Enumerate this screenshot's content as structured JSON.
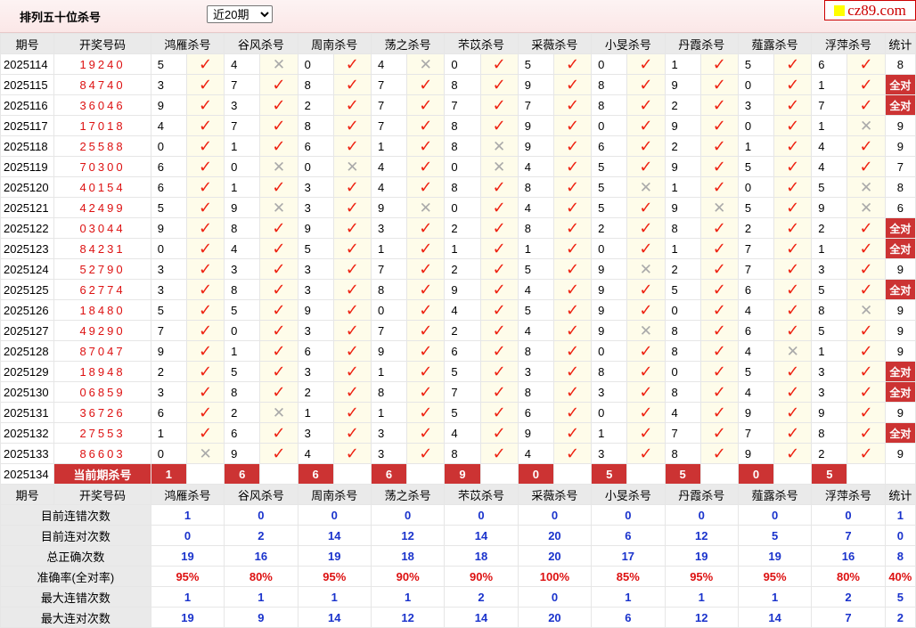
{
  "header": {
    "title": "排列五十位杀号",
    "period_select": "近20期",
    "logo": "cz89.com"
  },
  "columns": {
    "period": "期号",
    "draw": "开奖号码",
    "stat": "统计",
    "experts": [
      "鸿雁杀号",
      "谷风杀号",
      "周南杀号",
      "荡之杀号",
      "芣苡杀号",
      "采薇杀号",
      "小旻杀号",
      "丹霞杀号",
      "薤露杀号",
      "浮萍杀号"
    ]
  },
  "alltrue_label": "全对",
  "rows": [
    {
      "period": "2025114",
      "draw": "19240",
      "kills": [
        "5",
        "4",
        "0",
        "4",
        "0",
        "5",
        "0",
        "1",
        "5",
        "6"
      ],
      "ok": [
        1,
        0,
        1,
        0,
        1,
        1,
        1,
        1,
        1,
        1
      ],
      "stat": "8"
    },
    {
      "period": "2025115",
      "draw": "84740",
      "kills": [
        "3",
        "7",
        "8",
        "7",
        "8",
        "9",
        "8",
        "9",
        "0",
        "1"
      ],
      "ok": [
        1,
        1,
        1,
        1,
        1,
        1,
        1,
        1,
        1,
        1
      ],
      "stat": "全对"
    },
    {
      "period": "2025116",
      "draw": "36046",
      "kills": [
        "9",
        "3",
        "2",
        "7",
        "7",
        "7",
        "8",
        "2",
        "3",
        "7"
      ],
      "ok": [
        1,
        1,
        1,
        1,
        1,
        1,
        1,
        1,
        1,
        1
      ],
      "stat": "全对"
    },
    {
      "period": "2025117",
      "draw": "17018",
      "kills": [
        "4",
        "7",
        "8",
        "7",
        "8",
        "9",
        "0",
        "9",
        "0",
        "1"
      ],
      "ok": [
        1,
        1,
        1,
        1,
        1,
        1,
        1,
        1,
        1,
        0
      ],
      "stat": "9"
    },
    {
      "period": "2025118",
      "draw": "25588",
      "kills": [
        "0",
        "1",
        "6",
        "1",
        "8",
        "9",
        "6",
        "2",
        "1",
        "4"
      ],
      "ok": [
        1,
        1,
        1,
        1,
        0,
        1,
        1,
        1,
        1,
        1
      ],
      "stat": "9"
    },
    {
      "period": "2025119",
      "draw": "70300",
      "kills": [
        "6",
        "0",
        "0",
        "4",
        "0",
        "4",
        "5",
        "9",
        "5",
        "4"
      ],
      "ok": [
        1,
        0,
        0,
        1,
        0,
        1,
        1,
        1,
        1,
        1
      ],
      "stat": "7"
    },
    {
      "period": "2025120",
      "draw": "40154",
      "kills": [
        "6",
        "1",
        "3",
        "4",
        "8",
        "8",
        "5",
        "1",
        "0",
        "5"
      ],
      "ok": [
        1,
        1,
        1,
        1,
        1,
        1,
        0,
        1,
        1,
        0
      ],
      "stat": "8"
    },
    {
      "period": "2025121",
      "draw": "42499",
      "kills": [
        "5",
        "9",
        "3",
        "9",
        "0",
        "4",
        "5",
        "9",
        "5",
        "9"
      ],
      "ok": [
        1,
        0,
        1,
        0,
        1,
        1,
        1,
        0,
        1,
        0
      ],
      "stat": "6"
    },
    {
      "period": "2025122",
      "draw": "03044",
      "kills": [
        "9",
        "8",
        "9",
        "3",
        "2",
        "8",
        "2",
        "8",
        "2",
        "2"
      ],
      "ok": [
        1,
        1,
        1,
        1,
        1,
        1,
        1,
        1,
        1,
        1
      ],
      "stat": "全对"
    },
    {
      "period": "2025123",
      "draw": "84231",
      "kills": [
        "0",
        "4",
        "5",
        "1",
        "1",
        "1",
        "0",
        "1",
        "7",
        "1"
      ],
      "ok": [
        1,
        1,
        1,
        1,
        1,
        1,
        1,
        1,
        1,
        1
      ],
      "stat": "全对"
    },
    {
      "period": "2025124",
      "draw": "52790",
      "kills": [
        "3",
        "3",
        "3",
        "7",
        "2",
        "5",
        "9",
        "2",
        "7",
        "3"
      ],
      "ok": [
        1,
        1,
        1,
        1,
        1,
        1,
        0,
        1,
        1,
        1
      ],
      "stat": "9"
    },
    {
      "period": "2025125",
      "draw": "62774",
      "kills": [
        "3",
        "8",
        "3",
        "8",
        "9",
        "4",
        "9",
        "5",
        "6",
        "5"
      ],
      "ok": [
        1,
        1,
        1,
        1,
        1,
        1,
        1,
        1,
        1,
        1
      ],
      "stat": "全对"
    },
    {
      "period": "2025126",
      "draw": "18480",
      "kills": [
        "5",
        "5",
        "9",
        "0",
        "4",
        "5",
        "9",
        "0",
        "4",
        "8"
      ],
      "ok": [
        1,
        1,
        1,
        1,
        1,
        1,
        1,
        1,
        1,
        0
      ],
      "stat": "9"
    },
    {
      "period": "2025127",
      "draw": "49290",
      "kills": [
        "7",
        "0",
        "3",
        "7",
        "2",
        "4",
        "9",
        "8",
        "6",
        "5"
      ],
      "ok": [
        1,
        1,
        1,
        1,
        1,
        1,
        0,
        1,
        1,
        1
      ],
      "stat": "9"
    },
    {
      "period": "2025128",
      "draw": "87047",
      "kills": [
        "9",
        "1",
        "6",
        "9",
        "6",
        "8",
        "0",
        "8",
        "4",
        "1"
      ],
      "ok": [
        1,
        1,
        1,
        1,
        1,
        1,
        1,
        1,
        0,
        1
      ],
      "stat": "9"
    },
    {
      "period": "2025129",
      "draw": "18948",
      "kills": [
        "2",
        "5",
        "3",
        "1",
        "5",
        "3",
        "8",
        "0",
        "5",
        "3"
      ],
      "ok": [
        1,
        1,
        1,
        1,
        1,
        1,
        1,
        1,
        1,
        1
      ],
      "stat": "全对"
    },
    {
      "period": "2025130",
      "draw": "06859",
      "kills": [
        "3",
        "8",
        "2",
        "8",
        "7",
        "8",
        "3",
        "8",
        "4",
        "3"
      ],
      "ok": [
        1,
        1,
        1,
        1,
        1,
        1,
        1,
        1,
        1,
        1
      ],
      "stat": "全对"
    },
    {
      "period": "2025131",
      "draw": "36726",
      "kills": [
        "6",
        "2",
        "1",
        "1",
        "5",
        "6",
        "0",
        "4",
        "9",
        "9"
      ],
      "ok": [
        1,
        0,
        1,
        1,
        1,
        1,
        1,
        1,
        1,
        1
      ],
      "stat": "9"
    },
    {
      "period": "2025132",
      "draw": "27553",
      "kills": [
        "1",
        "6",
        "3",
        "3",
        "4",
        "9",
        "1",
        "7",
        "7",
        "8"
      ],
      "ok": [
        1,
        1,
        1,
        1,
        1,
        1,
        1,
        1,
        1,
        1
      ],
      "stat": "全对"
    },
    {
      "period": "2025133",
      "draw": "86603",
      "kills": [
        "0",
        "9",
        "4",
        "3",
        "8",
        "4",
        "3",
        "8",
        "9",
        "2"
      ],
      "ok": [
        0,
        1,
        1,
        1,
        1,
        1,
        1,
        1,
        1,
        1
      ],
      "stat": "9"
    }
  ],
  "current": {
    "period": "2025134",
    "label": "当前期杀号",
    "kills": [
      "1",
      "6",
      "6",
      "6",
      "9",
      "0",
      "5",
      "5",
      "0",
      "5"
    ]
  },
  "summary": [
    {
      "label": "目前连错次数",
      "values": [
        "1",
        "0",
        "0",
        "0",
        "0",
        "0",
        "0",
        "0",
        "0",
        "0"
      ],
      "stat": "1",
      "style": "blue"
    },
    {
      "label": "目前连对次数",
      "values": [
        "0",
        "2",
        "14",
        "12",
        "14",
        "20",
        "6",
        "12",
        "5",
        "7"
      ],
      "stat": "0",
      "style": "blue"
    },
    {
      "label": "总正确次数",
      "values": [
        "19",
        "16",
        "19",
        "18",
        "18",
        "20",
        "17",
        "19",
        "19",
        "16"
      ],
      "stat": "8",
      "style": "blue"
    },
    {
      "label": "准确率(全对率)",
      "values": [
        "95%",
        "80%",
        "95%",
        "90%",
        "90%",
        "100%",
        "85%",
        "95%",
        "95%",
        "80%"
      ],
      "stat": "40%",
      "style": "red"
    },
    {
      "label": "最大连错次数",
      "values": [
        "1",
        "1",
        "1",
        "1",
        "2",
        "0",
        "1",
        "1",
        "1",
        "2"
      ],
      "stat": "5",
      "style": "blue"
    },
    {
      "label": "最大连对次数",
      "values": [
        "19",
        "9",
        "14",
        "12",
        "14",
        "20",
        "6",
        "12",
        "14",
        "7"
      ],
      "stat": "2",
      "style": "blue"
    }
  ]
}
